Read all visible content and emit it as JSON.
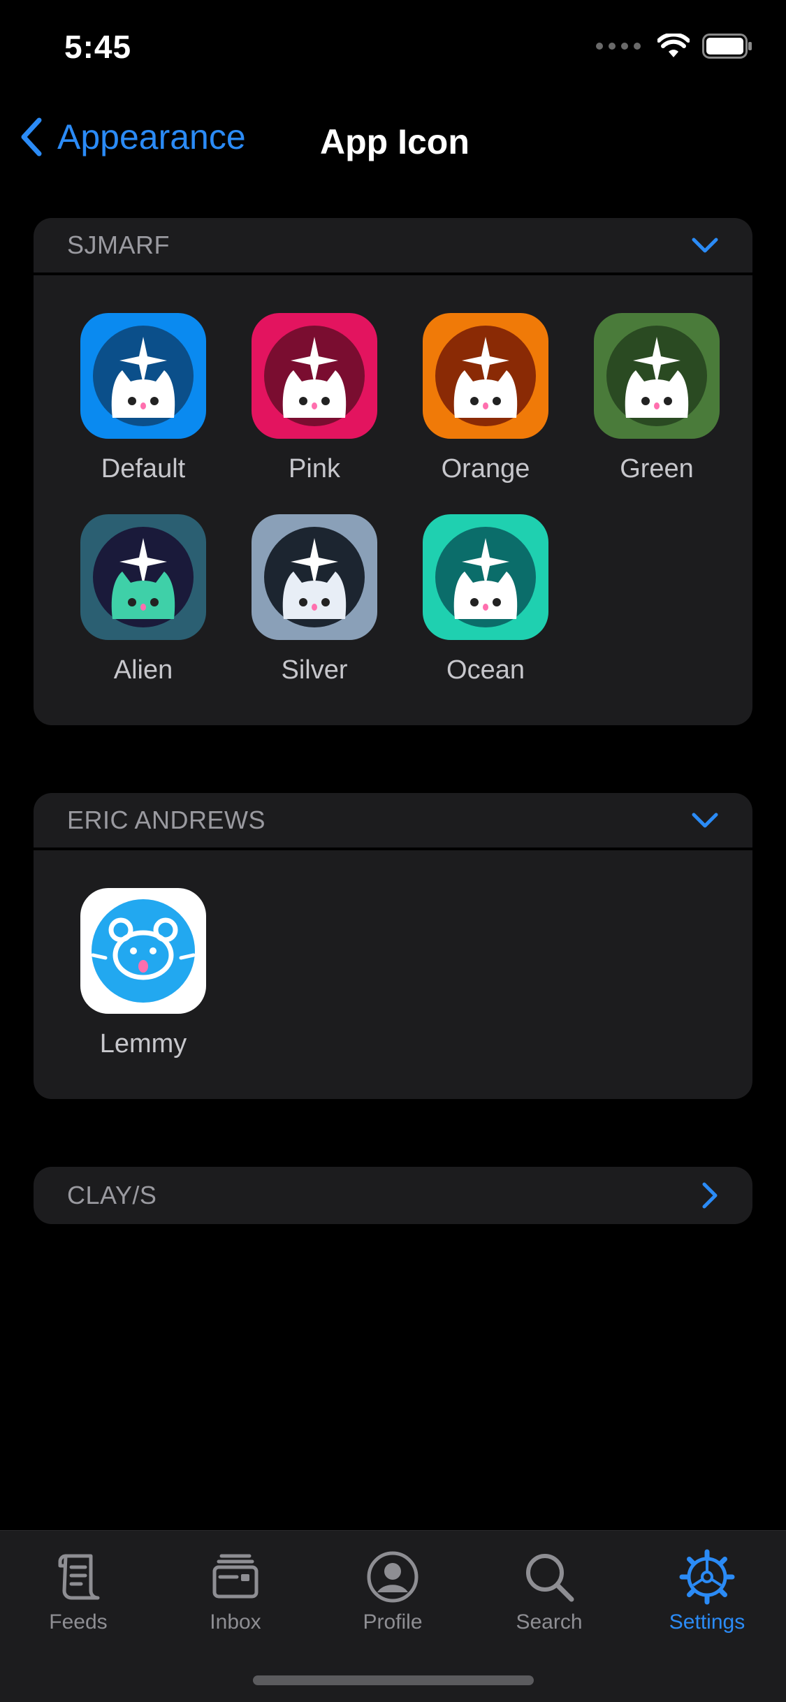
{
  "status_bar": {
    "time": "5:45"
  },
  "nav": {
    "back_label": "Appearance",
    "title": "App Icon"
  },
  "sections": [
    {
      "title": "SJMARF",
      "expanded": true,
      "icons": [
        {
          "label": "Default",
          "bg": "#0a8af0",
          "disc": "#0b4f8a",
          "face": "#ffffff"
        },
        {
          "label": "Pink",
          "bg": "#e3145f",
          "disc": "#7a0d30",
          "face": "#ffffff"
        },
        {
          "label": "Orange",
          "bg": "#f07a08",
          "disc": "#8a2a05",
          "face": "#ffffff"
        },
        {
          "label": "Green",
          "bg": "#4a7b3a",
          "disc": "#2a4a22",
          "face": "#ffffff"
        },
        {
          "label": "Alien",
          "bg": "#2b5f72",
          "disc": "#1a1a3a",
          "face": "#3fd0a8"
        },
        {
          "label": "Silver",
          "bg": "#8aa0b8",
          "disc": "#1c2530",
          "face": "#e8eef6"
        },
        {
          "label": "Ocean",
          "bg": "#1fd0b0",
          "disc": "#0b6d6a",
          "face": "#ffffff"
        }
      ]
    },
    {
      "title": "ERIC ANDREWS",
      "expanded": true,
      "icons": [
        {
          "label": "Lemmy",
          "bg": "#ffffff",
          "disc": "#22a8f0",
          "face": "#ffffff"
        }
      ]
    },
    {
      "title": "CLAY/S",
      "expanded": false,
      "icons": []
    }
  ],
  "tabs": [
    {
      "label": "Feeds",
      "icon": "scroll-icon",
      "active": false
    },
    {
      "label": "Inbox",
      "icon": "inbox-icon",
      "active": false
    },
    {
      "label": "Profile",
      "icon": "profile-icon",
      "active": false
    },
    {
      "label": "Search",
      "icon": "search-icon",
      "active": false
    },
    {
      "label": "Settings",
      "icon": "gear-icon",
      "active": true
    }
  ],
  "colors": {
    "accent": "#2b8bf6",
    "background": "#000000",
    "card": "#1c1c1e"
  }
}
